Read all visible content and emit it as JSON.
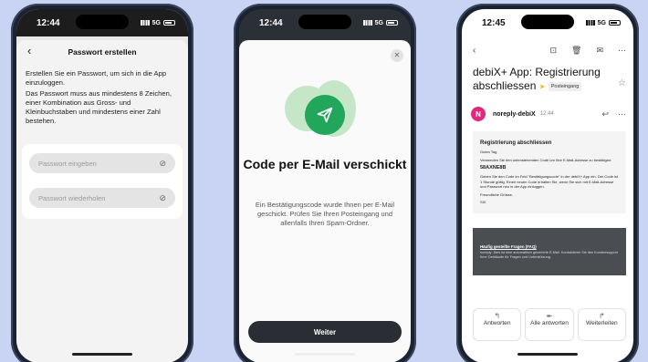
{
  "phone1": {
    "time": "12:44",
    "network": "5G",
    "title": "Passwort erstellen",
    "intro": "Erstellen Sie ein Passwort, um sich in die App einzuloggen.",
    "rules": "Das Passwort muss aus mindestens 8 Zeichen, einer Kombination aus Gross- und Kleinbuchstaben und mindestens einer Zahl bestehen.",
    "password_placeholder": "Passwort eingeben",
    "repeat_placeholder": "Passwort wiederholen"
  },
  "phone2": {
    "time": "12:44",
    "network": "5G",
    "title": "Code per E-Mail verschickt",
    "body": "Ein Bestätigungscode wurde Ihnen per E-Mail geschickt. Prüfen Sie Ihren Posteingang und allenfalls Ihren Spam-Ordner.",
    "button": "Weiter",
    "accent": "#21a65b"
  },
  "phone3": {
    "time": "12:45",
    "network": "5G",
    "subject": "debiX+ App: Registrierung abschliessen",
    "folder_tag": "Posteingang",
    "avatar_letter": "N",
    "sender": "noreply-debiX",
    "sent_time": "12:44",
    "mail": {
      "heading": "Registrierung abschliessen",
      "greeting": "Guten Tag",
      "line1": "Verwenden Sie den untenstehenden Code um Ihre E-Mail-Adresse zu bestätigen:",
      "code": "58AXNE8B",
      "line2": "Geben Sie den Code im Feld \"Bestätigungscode\" in der debiX+ App ein. Der Code ist 1 Stunde gültig. Einen neuen Code erhalten Sie, wenn Sie sich mit E-Mail-Adresse und Passwort neu in der App einloggen.",
      "closing": "Freundliche Grüsse,",
      "signature": "SIX"
    },
    "faq": {
      "title": "Häufig gestellte Fragen (FAQ)",
      "body": "noreply: Dies ist eine automatisch generierte E-Mail. Kontaktieren Sie den Kundensupport Ihrer Debitkarte für Fragen und Unterstützung."
    },
    "actions": {
      "reply": "Antworten",
      "reply_all": "Alle antworten",
      "forward": "Weiterleiten"
    },
    "avatar_color": "#e0287d"
  }
}
